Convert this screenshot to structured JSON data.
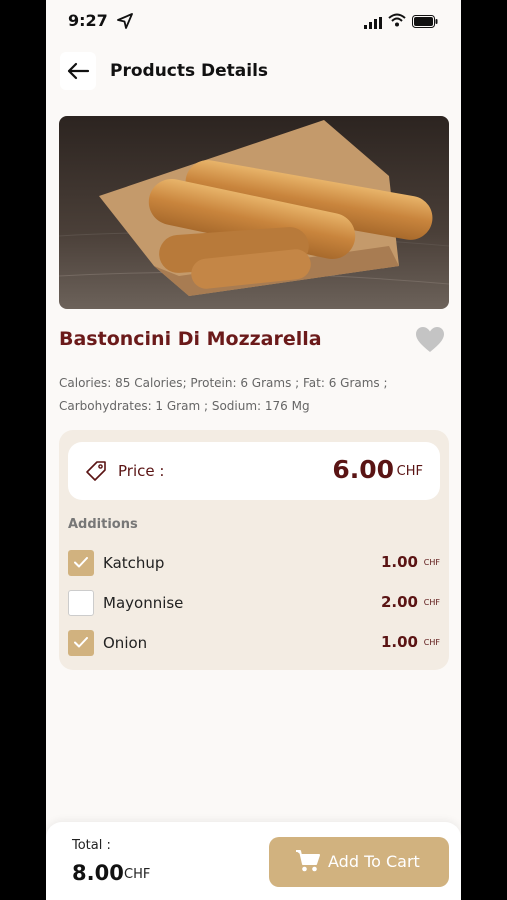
{
  "status_bar": {
    "time": "9:27"
  },
  "header": {
    "title": "Products Details"
  },
  "product": {
    "name": "Bastoncini Di Mozzarella",
    "nutrition_line1": "Calories: 85 Calories; Protein: 6 Grams ; Fat: 6 Grams ;",
    "nutrition_line2": "Carbohydrates: 1 Gram ; Sodium: 176 Mg"
  },
  "price": {
    "label": "Price :",
    "value": "6.00",
    "currency": "CHF"
  },
  "additions": {
    "heading": "Additions",
    "items": [
      {
        "name": "Katchup",
        "price": "1.00",
        "currency": "CHF",
        "checked": true
      },
      {
        "name": "Mayonnise",
        "price": "2.00",
        "currency": "CHF",
        "checked": false
      },
      {
        "name": "Onion",
        "price": "1.00",
        "currency": "CHF",
        "checked": true
      }
    ]
  },
  "footer": {
    "total_label": "Total :",
    "total_value": "8.00",
    "total_currency": "CHF",
    "add_to_cart": "Add To Cart"
  },
  "colors": {
    "accent": "#d1b27f",
    "brand_text": "#5a1414",
    "card_bg": "#f3ece3"
  }
}
